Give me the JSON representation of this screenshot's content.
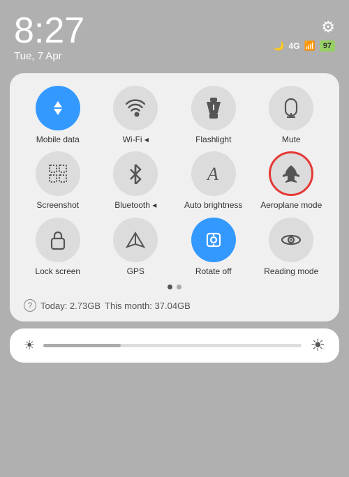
{
  "statusBar": {
    "time": "8:27",
    "date": "Tue, 7 Apr",
    "gearSymbol": "⚙",
    "moonSymbol": "🌙",
    "signalText": "4G",
    "batteryText": "97"
  },
  "tiles": [
    {
      "id": "mobile-data",
      "label": "Mobile data",
      "icon": "⇅",
      "active": true,
      "highlighted": false
    },
    {
      "id": "wifi",
      "label": "Wi-Fi ◂",
      "icon": "📶",
      "active": false,
      "highlighted": false
    },
    {
      "id": "flashlight",
      "label": "Flashlight",
      "icon": "🔦",
      "active": false,
      "highlighted": false
    },
    {
      "id": "mute",
      "label": "Mute",
      "icon": "🔔",
      "active": false,
      "highlighted": false
    },
    {
      "id": "screenshot",
      "label": "Screenshot",
      "icon": "✂",
      "active": false,
      "highlighted": false
    },
    {
      "id": "bluetooth",
      "label": "Bluetooth ◂",
      "icon": "✱",
      "active": false,
      "highlighted": false
    },
    {
      "id": "auto-brightness",
      "label": "Auto brightness",
      "icon": "A",
      "active": false,
      "highlighted": false
    },
    {
      "id": "aeroplane-mode",
      "label": "Aeroplane mode",
      "icon": "✈",
      "active": false,
      "highlighted": true
    },
    {
      "id": "lock-screen",
      "label": "Lock screen",
      "icon": "🔓",
      "active": false,
      "highlighted": false
    },
    {
      "id": "gps",
      "label": "GPS",
      "icon": "◁",
      "active": false,
      "highlighted": false
    },
    {
      "id": "rotate-off",
      "label": "Rotate off",
      "icon": "🔒",
      "active": true,
      "highlighted": false
    },
    {
      "id": "reading-mode",
      "label": "Reading mode",
      "icon": "👁",
      "active": false,
      "highlighted": false
    }
  ],
  "dots": [
    true,
    false
  ],
  "dataUsage": {
    "icon": "?",
    "today": "Today: 2.73GB",
    "thisMonth": "This month: 37.04GB"
  },
  "brightness": {
    "lowIcon": "☀",
    "highIcon": "☀"
  }
}
